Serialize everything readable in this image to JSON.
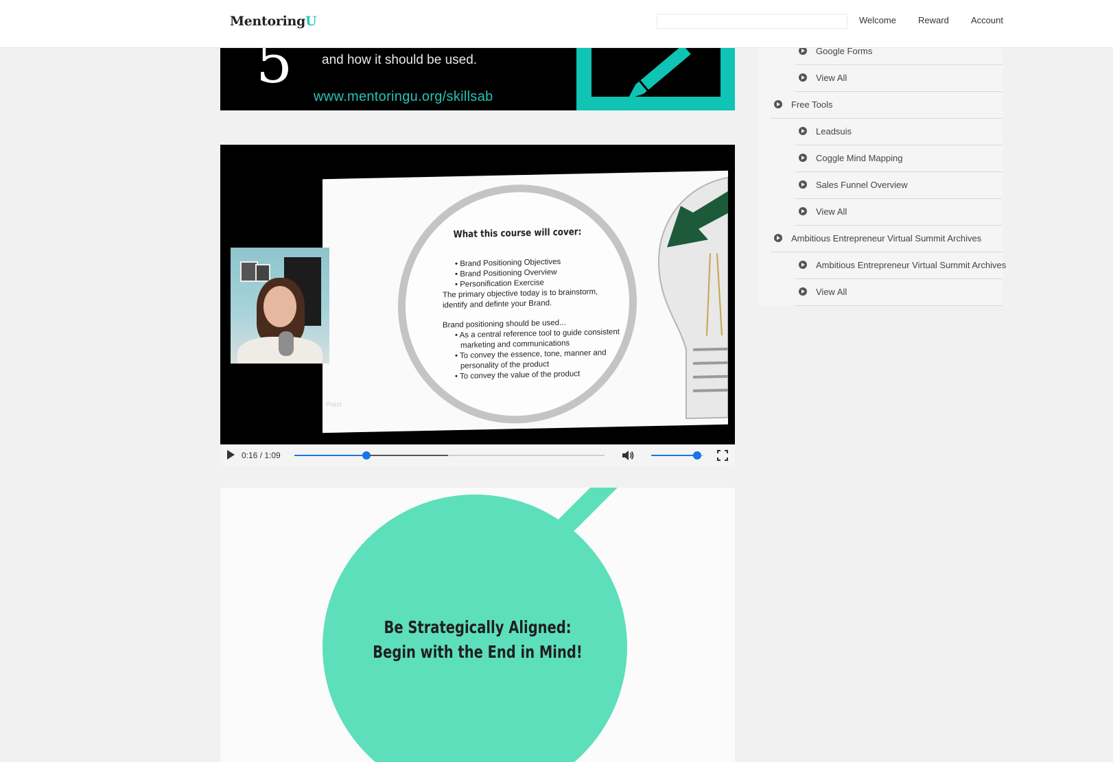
{
  "header": {
    "logo": {
      "text": "Mentoring",
      "accent": "U"
    },
    "search": {
      "value": "",
      "placeholder": ""
    },
    "nav": [
      "Welcome",
      "Reward",
      "Account"
    ]
  },
  "banner": {
    "digit": "5",
    "text": "and how it should be used.",
    "url": "www.mentoringu.org/skillsab"
  },
  "video": {
    "slide_title": "What this course will cover:",
    "bullets1": [
      "Brand Positioning Objectives",
      "Brand Positioning Overview",
      "Personification Exercise"
    ],
    "paragraph": "The primary objective today is to brainstorm, identify and definte your Brand.",
    "paragraph2": "Brand positioning should be used...",
    "bullets2": [
      "As a central reference tool to guide consistent marketing and communications",
      "To convey the essence, tone, manner and personality of the product",
      "To convey the value of the product"
    ],
    "watermark": "Prezi",
    "controls": {
      "time": "0:16 / 1:09",
      "progress": 0.232,
      "buffered": 0.496,
      "volume": 0.88
    }
  },
  "panel": {
    "line1": "Be Strategically Aligned:",
    "line2": "Begin with the End in Mind!"
  },
  "sidebar": {
    "items": [
      {
        "label": "Google Forms",
        "level": "child"
      },
      {
        "label": "View All",
        "level": "child"
      },
      {
        "label": "Free Tools",
        "level": "parent"
      },
      {
        "label": "Leadsuis",
        "level": "child"
      },
      {
        "label": "Coggle Mind Mapping",
        "level": "child"
      },
      {
        "label": "Sales Funnel Overview",
        "level": "child"
      },
      {
        "label": "View All",
        "level": "child"
      },
      {
        "label": "Ambitious Entrepreneur Virtual Summit Archives",
        "level": "parent"
      },
      {
        "label": "Ambitious Entrepreneur Virtual Summit Archives",
        "level": "child"
      },
      {
        "label": "View All",
        "level": "child"
      }
    ]
  },
  "colors": {
    "accent": "#23c9b8",
    "mint": "#5ddfbb",
    "player_blue": "#1a73e8"
  },
  "icons": {
    "sidebar_item": "chevron-circle-right-icon",
    "play": "play-icon",
    "volume": "volume-icon",
    "fullscreen": "fullscreen-icon"
  }
}
